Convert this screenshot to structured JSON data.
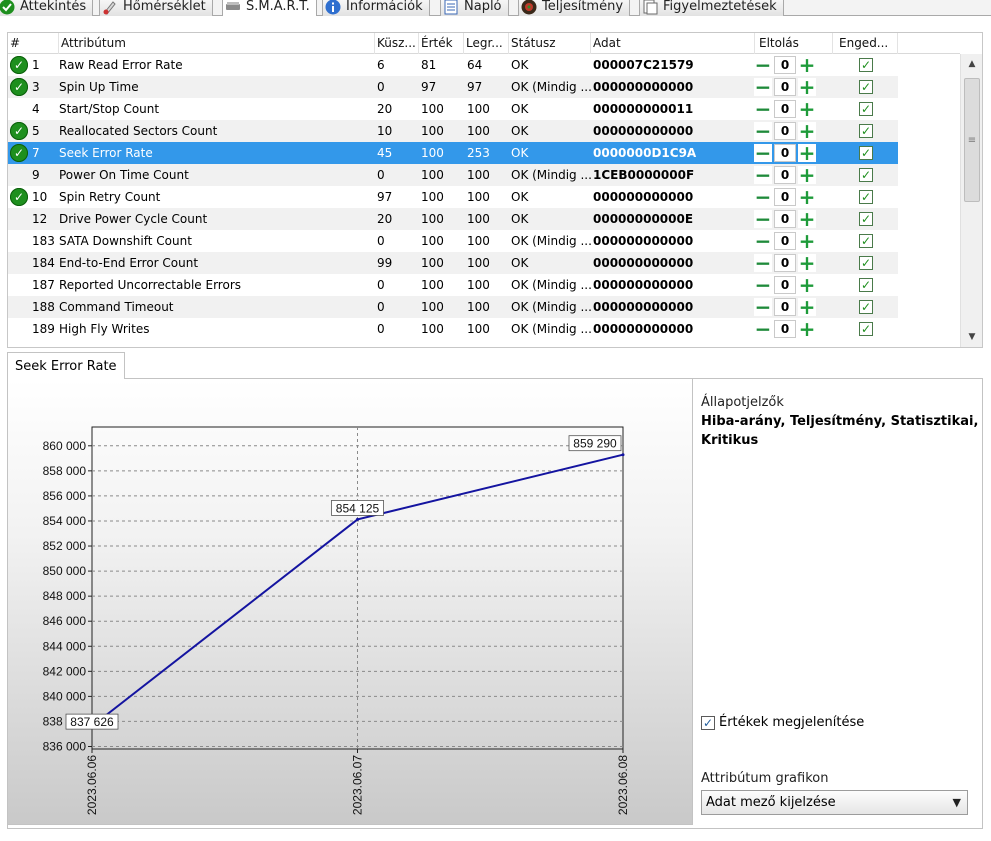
{
  "tabs": [
    {
      "label": "Áttekintés",
      "icon": "check-circle-icon"
    },
    {
      "label": "Hőmérséklet",
      "icon": "thermometer-icon"
    },
    {
      "label": "S.M.A.R.T.",
      "icon": "drive-icon",
      "active": true
    },
    {
      "label": "Információk",
      "icon": "info-icon"
    },
    {
      "label": "Napló",
      "icon": "log-icon"
    },
    {
      "label": "Teljesítmény",
      "icon": "performance-icon"
    },
    {
      "label": "Figyelmeztetések",
      "icon": "warnings-icon"
    }
  ],
  "table": {
    "headers": {
      "num": "#",
      "attr": "Attribútum",
      "threshold": "Küsz...",
      "value": "Érték",
      "worst": "Legr...",
      "status": "Státusz",
      "data": "Adat",
      "offset": "Eltolás",
      "enabled": "Enged..."
    },
    "rows": [
      {
        "icon": true,
        "id": "1",
        "name": "Raw Read Error Rate",
        "threshold": "6",
        "value": "81",
        "worst": "64",
        "status": "OK",
        "data": "000007C21579",
        "offset": "0"
      },
      {
        "icon": true,
        "id": "3",
        "name": "Spin Up Time",
        "threshold": "0",
        "value": "97",
        "worst": "97",
        "status": "OK (Mindig ...",
        "data": "000000000000",
        "offset": "0"
      },
      {
        "icon": false,
        "id": "4",
        "name": "Start/Stop Count",
        "threshold": "20",
        "value": "100",
        "worst": "100",
        "status": "OK",
        "data": "000000000011",
        "offset": "0"
      },
      {
        "icon": true,
        "id": "5",
        "name": "Reallocated Sectors Count",
        "threshold": "10",
        "value": "100",
        "worst": "100",
        "status": "OK",
        "data": "000000000000",
        "offset": "0"
      },
      {
        "icon": true,
        "id": "7",
        "name": "Seek Error Rate",
        "threshold": "45",
        "value": "100",
        "worst": "253",
        "status": "OK",
        "data": "0000000D1C9A",
        "offset": "0",
        "selected": true
      },
      {
        "icon": false,
        "id": "9",
        "name": "Power On Time Count",
        "threshold": "0",
        "value": "100",
        "worst": "100",
        "status": "OK (Mindig ...",
        "data": "1CEB0000000F",
        "offset": "0"
      },
      {
        "icon": true,
        "id": "10",
        "name": "Spin Retry Count",
        "threshold": "97",
        "value": "100",
        "worst": "100",
        "status": "OK",
        "data": "000000000000",
        "offset": "0"
      },
      {
        "icon": false,
        "id": "12",
        "name": "Drive Power Cycle Count",
        "threshold": "20",
        "value": "100",
        "worst": "100",
        "status": "OK",
        "data": "00000000000E",
        "offset": "0"
      },
      {
        "icon": false,
        "id": "183",
        "name": "SATA Downshift Count",
        "threshold": "0",
        "value": "100",
        "worst": "100",
        "status": "OK (Mindig ...",
        "data": "000000000000",
        "offset": "0"
      },
      {
        "icon": false,
        "id": "184",
        "name": "End-to-End Error Count",
        "threshold": "99",
        "value": "100",
        "worst": "100",
        "status": "OK",
        "data": "000000000000",
        "offset": "0"
      },
      {
        "icon": false,
        "id": "187",
        "name": "Reported Uncorrectable Errors",
        "threshold": "0",
        "value": "100",
        "worst": "100",
        "status": "OK (Mindig ...",
        "data": "000000000000",
        "offset": "0"
      },
      {
        "icon": false,
        "id": "188",
        "name": "Command Timeout",
        "threshold": "0",
        "value": "100",
        "worst": "100",
        "status": "OK (Mindig ...",
        "data": "000000000000",
        "offset": "0"
      },
      {
        "icon": false,
        "id": "189",
        "name": "High Fly Writes",
        "threshold": "0",
        "value": "100",
        "worst": "100",
        "status": "OK (Mindig ...",
        "data": "000000000000",
        "offset": "0"
      }
    ]
  },
  "detail": {
    "tab_label": "Seek Error Rate",
    "indicators_label": "Állapotjelzők",
    "indicators_value": "Hiba-arány, Teljesítmény, Statisztikai, Kritikus",
    "show_values_label": "Értékek megjelenítése",
    "graph_label": "Attribútum grafikon",
    "graph_select": "Adat mező kijelzése"
  },
  "chart_data": {
    "type": "line",
    "x": [
      "2023.06.06",
      "2023.06.07",
      "2023.06.08"
    ],
    "series": [
      {
        "values": [
          837626,
          854125,
          859290
        ]
      }
    ],
    "data_labels": [
      "837 626",
      "854 125",
      "859 290"
    ],
    "y_ticks": [
      "836 000",
      "838 000",
      "840 000",
      "842 000",
      "844 000",
      "846 000",
      "848 000",
      "850 000",
      "852 000",
      "854 000",
      "856 000",
      "858 000",
      "860 000"
    ],
    "ylim": [
      835800,
      861500
    ],
    "line_color": "#1414a0",
    "grid": true
  }
}
